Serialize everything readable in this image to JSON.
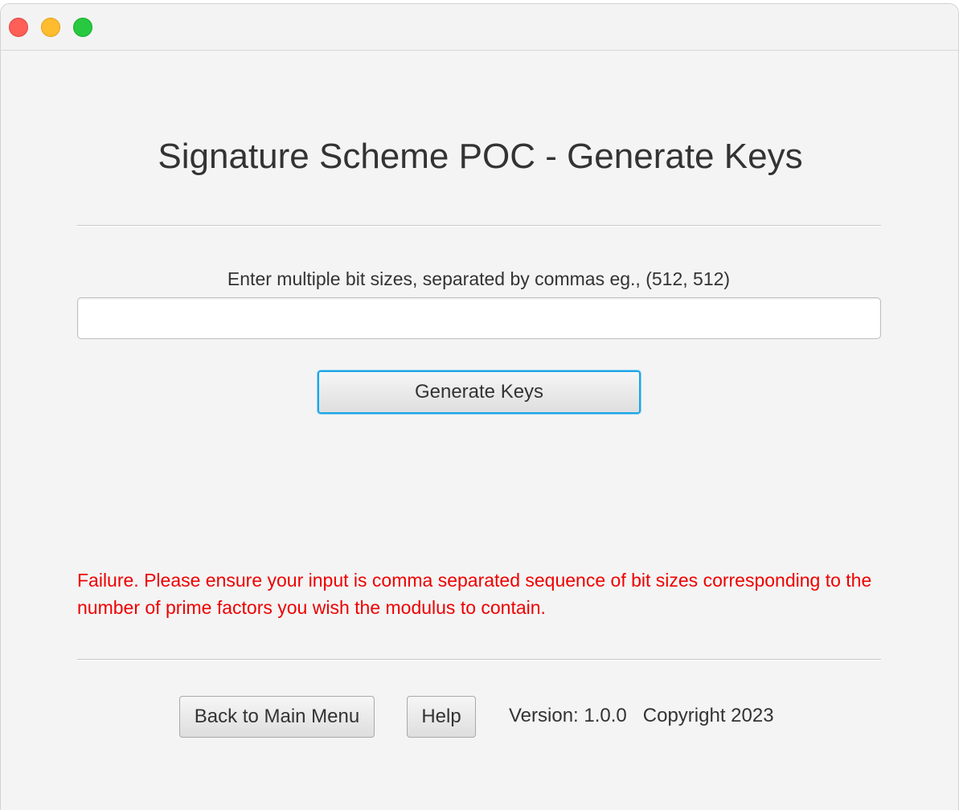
{
  "window": {
    "controls": [
      "close",
      "minimize",
      "maximize"
    ]
  },
  "page": {
    "title": "Signature Scheme POC - Generate Keys",
    "input_label": "Enter multiple bit sizes, separated by commas eg., (512, 512)",
    "input_value": "",
    "generate_button": "Generate Keys",
    "error_message": "Failure. Please ensure your input is comma separated sequence of bit sizes corresponding to the number of prime factors you wish the modulus to contain."
  },
  "footer": {
    "back_button": "Back to Main Menu",
    "help_button": "Help",
    "version_text": "Version: 1.0.0   Copyright 2023"
  },
  "colors": {
    "error": "#ee0000",
    "focus_ring": "#19a6e6",
    "background": "#f4f4f4"
  }
}
